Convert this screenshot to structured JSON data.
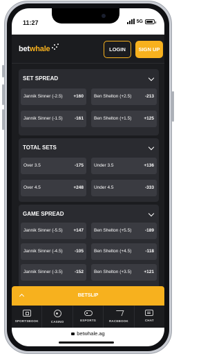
{
  "status_bar": {
    "time": "11:27",
    "network": "5G"
  },
  "header": {
    "logo_main": "bet",
    "logo_accent": "whale",
    "login_label": "LOGIN",
    "signup_label": "SIGN UP"
  },
  "markets": [
    {
      "title": "SET SPREAD",
      "rows": [
        [
          {
            "label": "Jannik Sinner (-2.5)",
            "odds": "+160"
          },
          {
            "label": "Ben Shelton (+2.5)",
            "odds": "-213"
          }
        ],
        [
          {
            "label": "Jannik Sinner (-1.5)",
            "odds": "-161"
          },
          {
            "label": "Ben Shelton (+1.5)",
            "odds": "+125"
          }
        ]
      ]
    },
    {
      "title": "TOTAL SETS",
      "rows": [
        [
          {
            "label": "Over 3.5",
            "odds": "-175"
          },
          {
            "label": "Under 3.5",
            "odds": "+136"
          }
        ],
        [
          {
            "label": "Over 4.5",
            "odds": "+248"
          },
          {
            "label": "Under 4.5",
            "odds": "-333"
          }
        ]
      ]
    },
    {
      "title": "GAME SPREAD",
      "rows": [
        [
          {
            "label": "Jannik Sinner (-5.5)",
            "odds": "+147"
          },
          {
            "label": "Ben Shelton (+5.5)",
            "odds": "-189"
          }
        ],
        [
          {
            "label": "Jannik Sinner (-4.5)",
            "odds": "-105"
          },
          {
            "label": "Ben Shelton (+4.5)",
            "odds": "-118"
          }
        ],
        [
          {
            "label": "Jannik Sinner (-3.5)",
            "odds": "-152"
          },
          {
            "label": "Ben Shelton (+3.5)",
            "odds": "+121"
          }
        ]
      ]
    }
  ],
  "betslip": {
    "label": "BETSLIP"
  },
  "bottom_nav": [
    {
      "label": "SPORTSBOOK",
      "icon": "sportsbook-icon"
    },
    {
      "label": "CASINO",
      "icon": "casino-icon"
    },
    {
      "label": "ESPORTS",
      "icon": "esports-icon"
    },
    {
      "label": "RACEBOOK",
      "icon": "racebook-icon"
    },
    {
      "label": "CHAT",
      "icon": "chat-icon"
    }
  ],
  "url_bar": {
    "url": "betwhale.ag"
  },
  "colors": {
    "accent": "#f7b11e",
    "background": "#1b1c1f",
    "card": "#2a2b30",
    "button": "#3a3b41"
  }
}
